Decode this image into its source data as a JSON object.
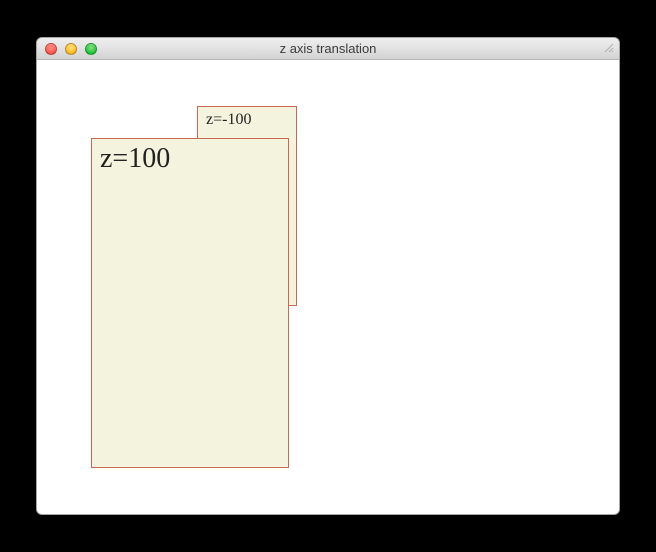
{
  "window": {
    "title": "z axis translation"
  },
  "boxes": {
    "back_label": "z=-100",
    "front_label": "z=100"
  }
}
